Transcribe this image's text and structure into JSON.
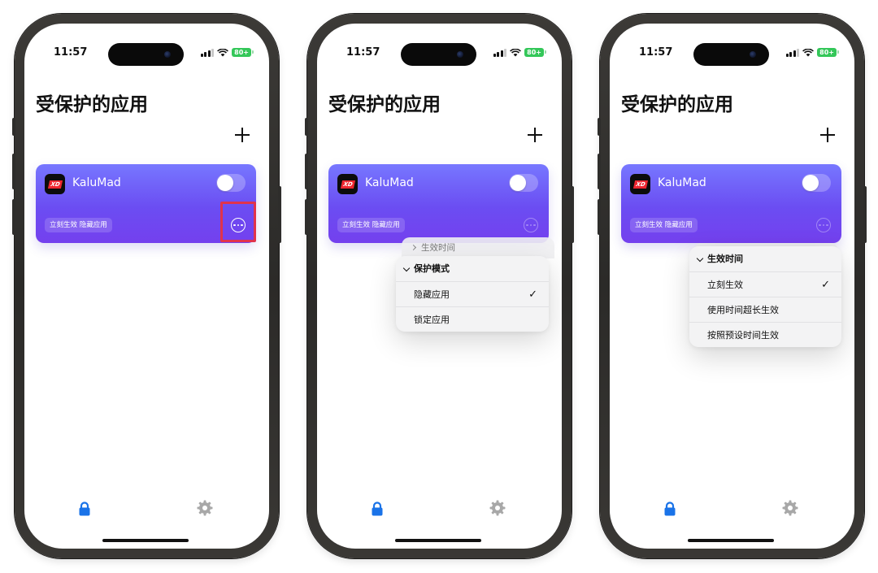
{
  "status_bar": {
    "time": "11:57",
    "battery": "80+"
  },
  "page": {
    "title": "受保护的应用"
  },
  "app": {
    "name": "KaluMad",
    "icon_text": "XD",
    "tags": "立刻生效 隐藏应用"
  },
  "menu_mode": {
    "behind_label": "生效时间",
    "header": "保护模式",
    "items": [
      {
        "label": "隐藏应用",
        "checked": true
      },
      {
        "label": "锁定应用",
        "checked": false
      }
    ]
  },
  "menu_time": {
    "header": "生效时间",
    "items": [
      {
        "label": "立刻生效",
        "checked": true
      },
      {
        "label": "使用时间超长生效",
        "checked": false
      },
      {
        "label": "按照预设时间生效",
        "checked": false
      }
    ]
  },
  "check_mark": "✓",
  "colors": {
    "card_top": "#7777ff",
    "card_bottom": "#7440ee",
    "tab_active": "#1a73e8",
    "tab_inactive": "#a8a8a8",
    "highlight": "#e0334c",
    "battery": "#34c759"
  },
  "icons": {
    "tab_protected": "lock-icon",
    "tab_settings": "gear-icon",
    "add": "plus-icon",
    "more": "more-circle-icon"
  }
}
